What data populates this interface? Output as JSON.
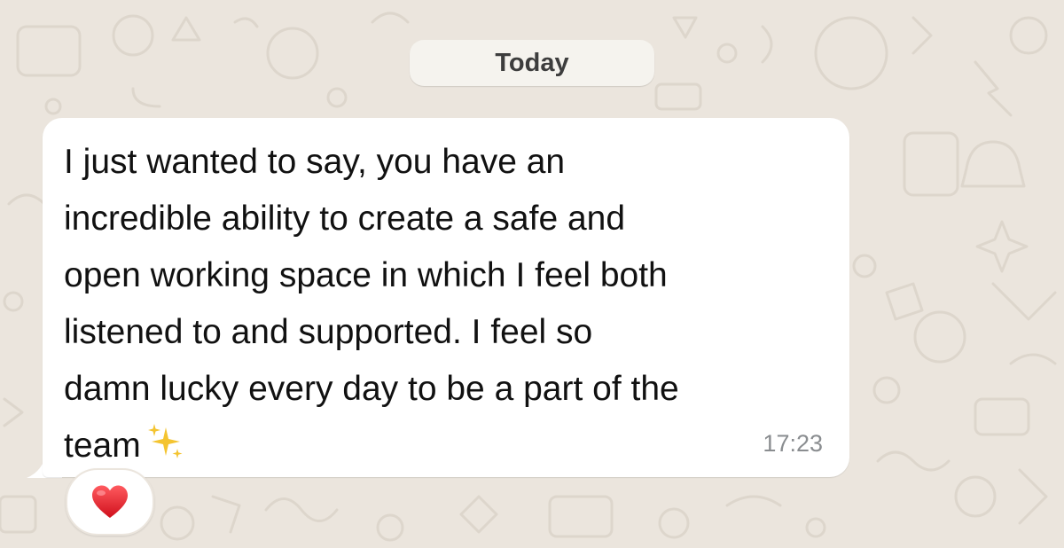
{
  "chat": {
    "date_separator": "Today",
    "message": {
      "text": "I just wanted to say, you have an\nincredible ability to create a safe and\nopen working space in which I feel both\nlistened to and supported. I feel so\ndamn lucky every day to be a part of the\nteam",
      "emoji_icon": "sparkles-icon",
      "time": "17:23",
      "reaction_icon": "red-heart-icon"
    }
  },
  "colors": {
    "background": "#ebe5dd",
    "bubble": "#ffffff",
    "text": "#111111",
    "timestamp": "#8a8d90",
    "heart": "#e0202e",
    "sparkle": "#f4c430"
  }
}
